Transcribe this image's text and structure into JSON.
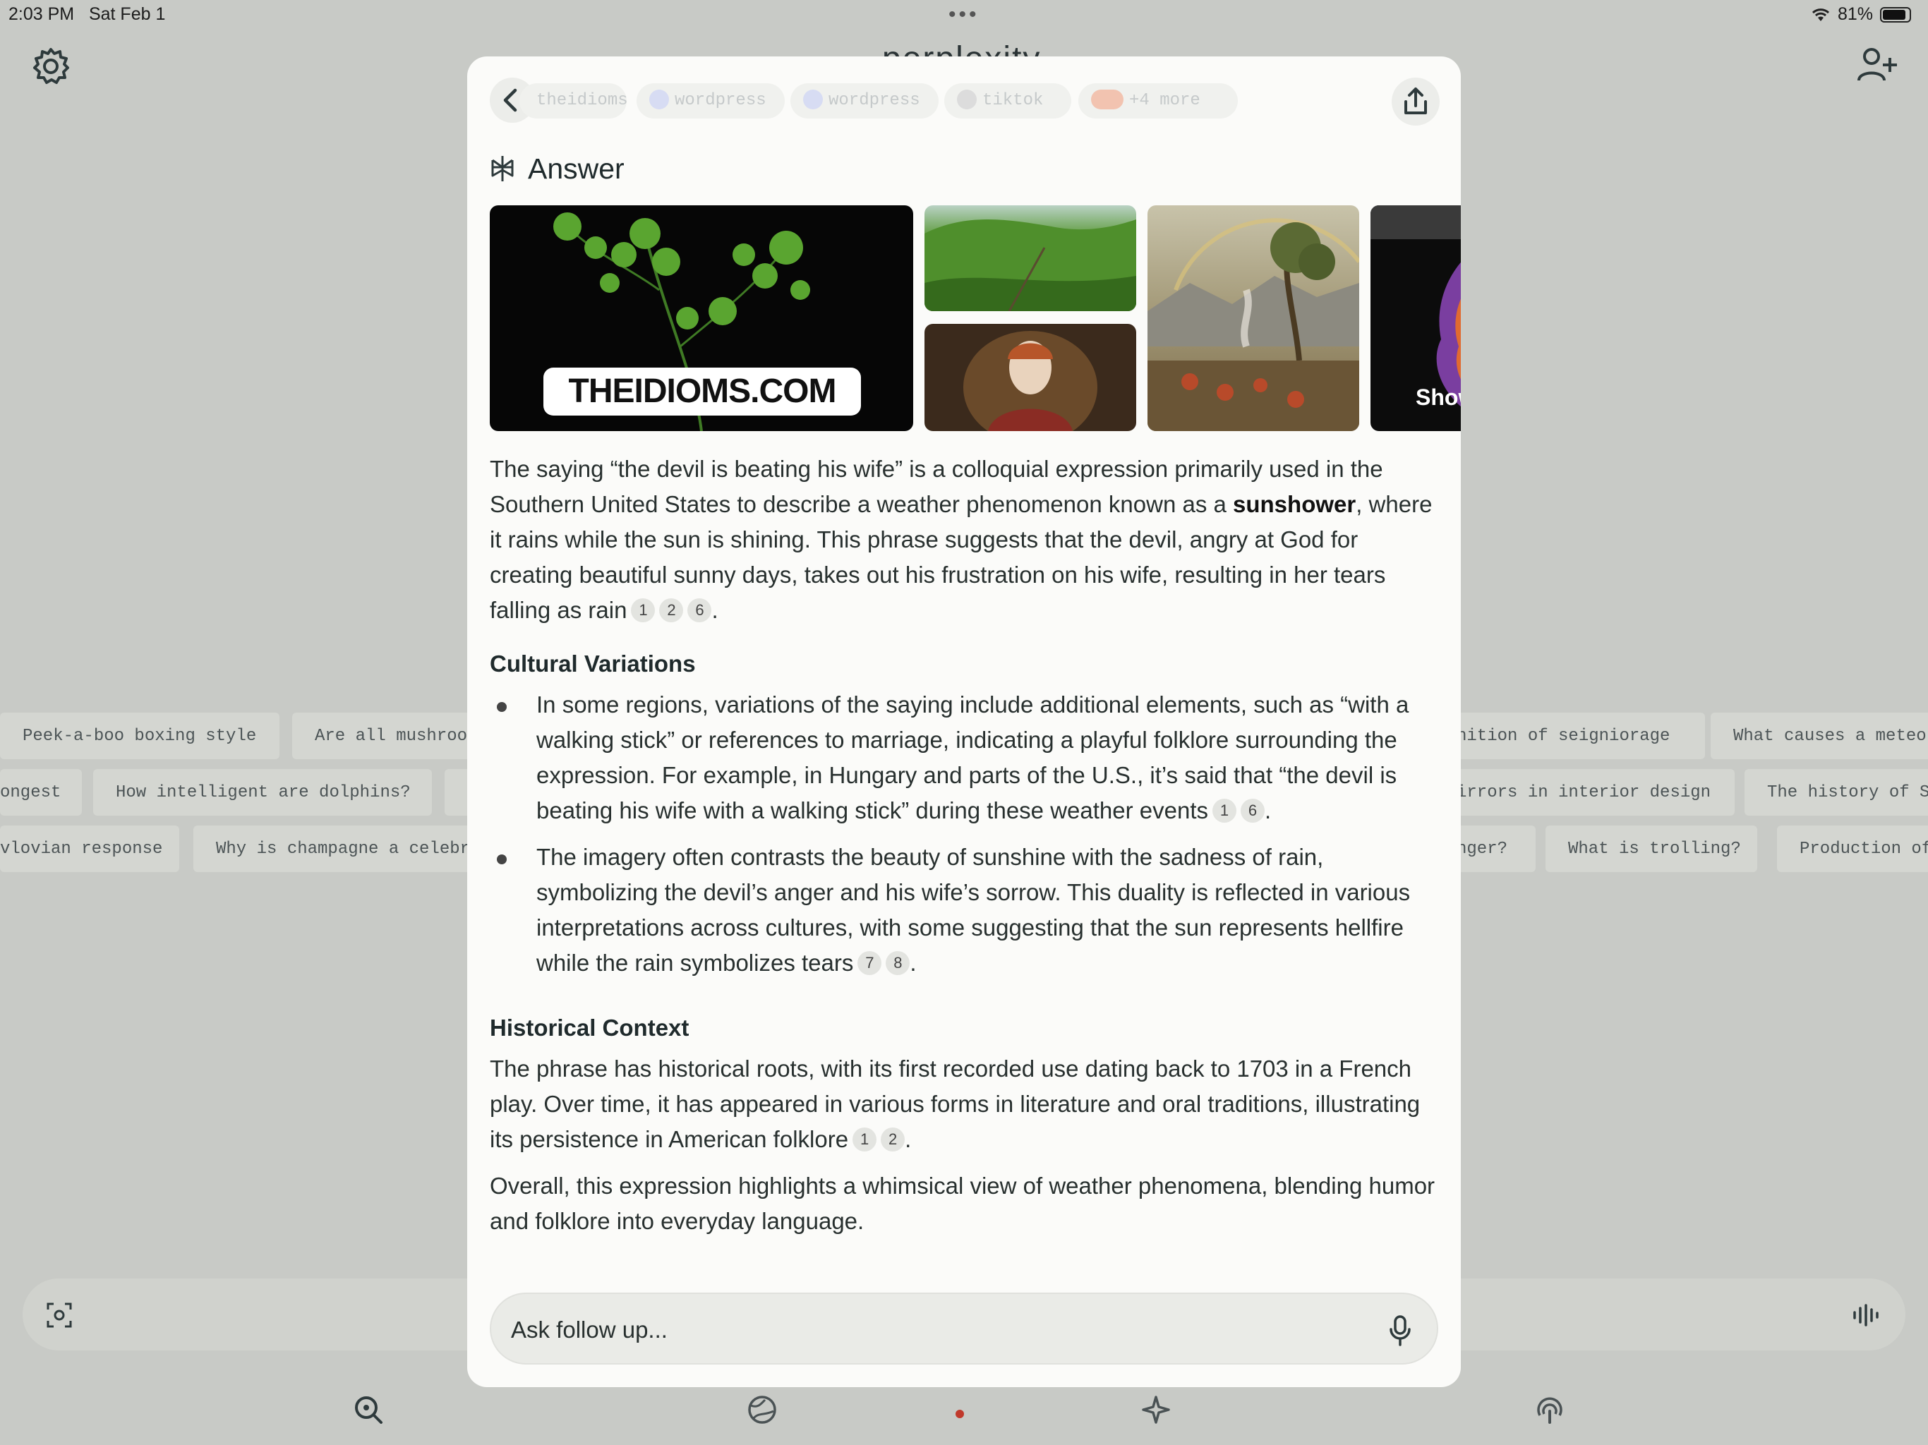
{
  "status_bar": {
    "time": "2:03 PM",
    "date": "Sat Feb 1",
    "battery": "81%"
  },
  "background": {
    "logo": "perplexity",
    "chip_rows": [
      [
        "Peek-a-boo boxing style",
        "Are all mushroo",
        "nition of seigniorage",
        "What causes a meteo"
      ],
      [
        "ongest",
        "How intelligent are dolphins?",
        "",
        "irrors in interior design",
        "The history of S"
      ],
      [
        "vlovian response",
        "Why is champagne a celebr",
        "nger?",
        "What is trolling?",
        "Production of"
      ]
    ]
  },
  "modal": {
    "sources": [
      "theidioms",
      "wordpress",
      "wordpress",
      "tiktok",
      "+4 more"
    ],
    "answer_label": "Answer",
    "image_overlay_text": "THEIDIOMS.COM",
    "image_show_text": "Show",
    "para1": {
      "before": "The saying “the devil is beating his wife” is a colloquial expression primarily used in the Southern United States to describe a weather phenomenon known as a ",
      "bold": "sunshower",
      "after": ", where it rains while the sun is shining. This phrase suggests that the devil, angry at God for creating beautiful sunny days, takes out his frustration on his wife, resulting in her tears falling as rain",
      "cites": [
        "1",
        "2",
        "6"
      ]
    },
    "section1_title": "Cultural Variations",
    "bullet1": {
      "text": "In some regions, variations of the saying include additional elements, such as “with a walking stick” or references to marriage, indicating a playful folklore surrounding the expression. For example, in Hungary and parts of the U.S., it’s said that “the devil is beating his wife with a walking stick” during these weather events",
      "cites": [
        "1",
        "6"
      ]
    },
    "bullet2": {
      "text": "The imagery often contrasts the beauty of sunshine with the sadness of rain, symbolizing the devil’s anger and his wife’s sorrow. This duality is reflected in various interpretations across cultures, with some suggesting that the sun represents hellfire while the rain symbolizes tears",
      "cites": [
        "7",
        "8"
      ]
    },
    "section2_title": "Historical Context",
    "para2": {
      "text": "The phrase has historical roots, with its first recorded use dating back to 1703 in a French play. Over time, it has appeared in various forms in literature and oral traditions, illustrating its persistence in American folklore",
      "cites": [
        "1",
        "2"
      ]
    },
    "para3": "Overall, this expression highlights a whimsical view of weather phenomena, blending humor and folklore into everyday language.",
    "followup_placeholder": "Ask follow up..."
  },
  "icons": {
    "settings": "gear-icon",
    "add_user": "add-user-icon",
    "back": "chevron-left-icon",
    "share": "share-icon",
    "answer": "perplexity-logo-icon",
    "mic": "microphone-icon",
    "scan": "scan-icon",
    "wave": "voice-wave-icon",
    "nav": [
      "search-icon",
      "globe-icon",
      "sparkle-icon",
      "broadcast-icon"
    ]
  }
}
